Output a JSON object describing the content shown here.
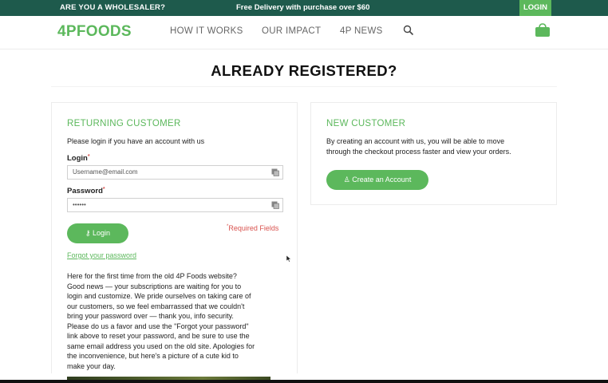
{
  "topbar": {
    "wholesale_text": "ARE YOU A WHOLESALER?",
    "delivery_text": "Free Delivery with purchase over $60",
    "login_label": "LOGIN"
  },
  "nav": {
    "logo": "4PFOODS",
    "links": [
      "HOW IT WORKS",
      "OUR IMPACT",
      "4P NEWS"
    ],
    "search_icon": "search-icon",
    "cart_icon": "shopping-bag-icon"
  },
  "page": {
    "title": "ALREADY REGISTERED?"
  },
  "returning": {
    "title": "RETURNING CUSTOMER",
    "intro": "Please login if you have an account with us",
    "login_label": "Login",
    "login_value": "Username@email.com",
    "password_label": "Password",
    "password_value": "••••••",
    "required_mark": "*",
    "login_button": "Login",
    "required_fields": "Required Fields",
    "forgot_link": "Forgot your password",
    "info_lines": [
      "Here for the first time from the old 4P Foods website?",
      "Good news — your subscriptions are waiting for you to",
      "login and customize. We pride ourselves on taking care of",
      "our customers, so we feel embarrassed that we couldn't",
      "bring your password over — thank you, info security.",
      "Please do us a favor and use the \"Forgot your password\"",
      "link above to reset your password, and be sure to use the",
      "same email address you used on the old site. Apologies for",
      "the inconvenience, but here's a picture of a cute kid to",
      "make your day."
    ]
  },
  "new_customer": {
    "title": "NEW CUSTOMER",
    "description_lines": [
      "By creating an account with us, you will be able to move",
      "through the checkout process faster and view your orders."
    ],
    "create_button": "Create an Account"
  },
  "colors": {
    "brand_green": "#5cb85c",
    "topbar_bg": "#1e5a4c",
    "required_red": "#d9534f"
  }
}
